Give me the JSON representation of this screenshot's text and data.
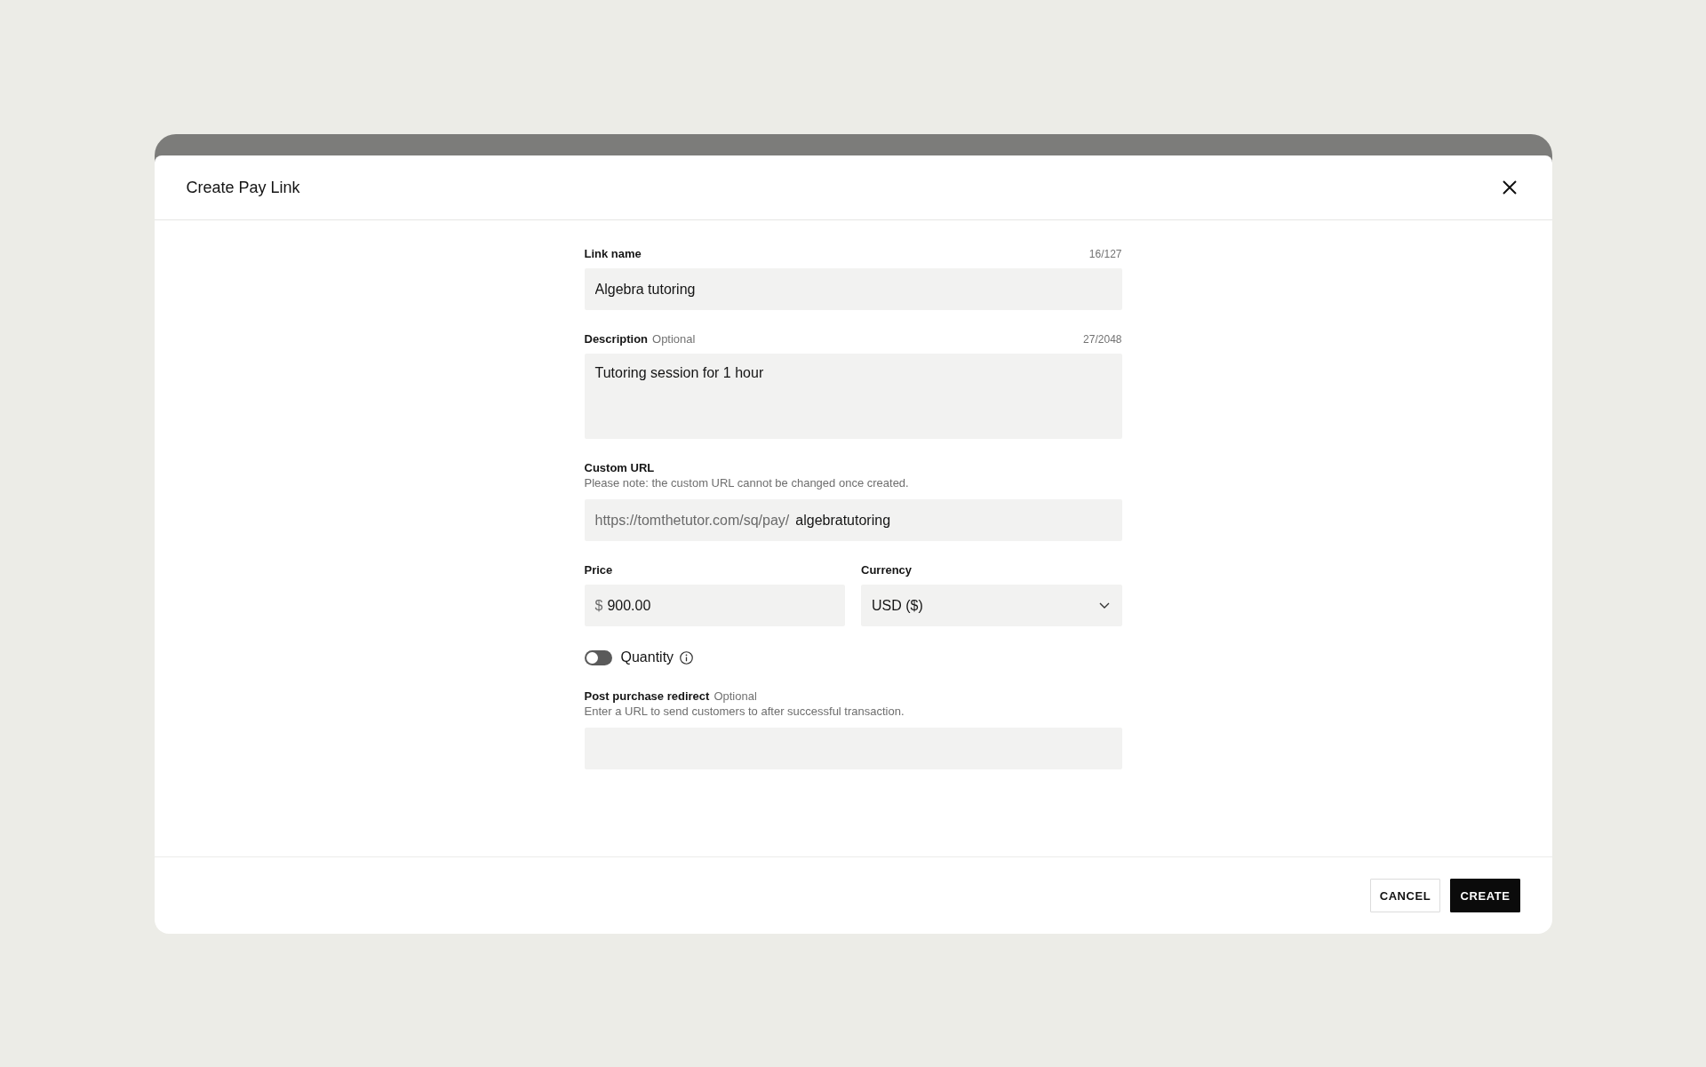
{
  "dialog": {
    "title": "Create Pay Link"
  },
  "link_name": {
    "label": "Link name",
    "counter": "16/127",
    "value": "Algebra tutoring"
  },
  "description": {
    "label": "Description",
    "optional": "Optional",
    "counter": "27/2048",
    "value": "Tutoring session for 1 hour"
  },
  "custom_url": {
    "label": "Custom URL",
    "note": "Please note: the custom URL cannot be changed once created.",
    "prefix": "https://tomthetutor.com/sq/pay/",
    "value": "algebratutoring"
  },
  "price": {
    "label": "Price",
    "symbol": "$",
    "value": "900.00"
  },
  "currency": {
    "label": "Currency",
    "value": "USD ($)"
  },
  "quantity": {
    "label": "Quantity",
    "on": false
  },
  "redirect": {
    "label": "Post purchase redirect",
    "optional": "Optional",
    "note": "Enter a URL to send customers to after successful transaction."
  },
  "buttons": [
    {
      "label": "CANCEL",
      "kind": "secondary"
    },
    {
      "label": "CREATE",
      "kind": "primary"
    }
  ]
}
